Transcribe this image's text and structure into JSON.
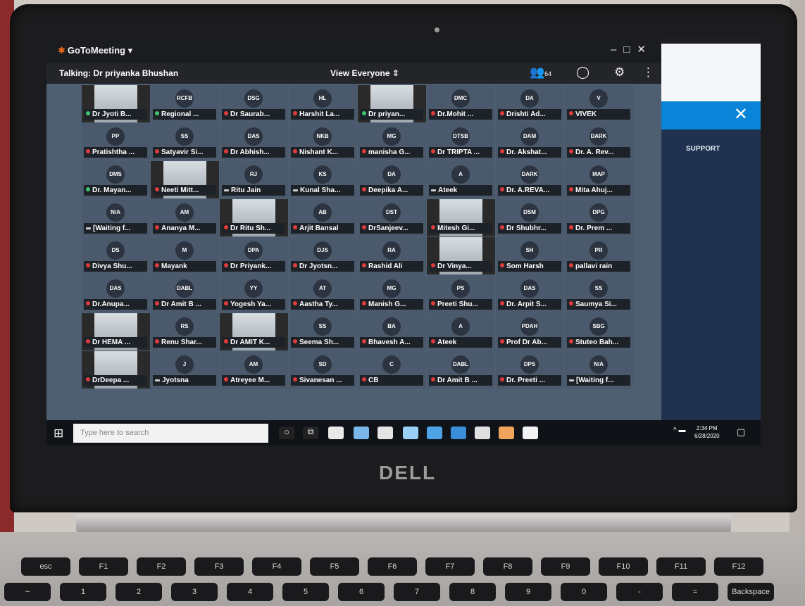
{
  "app": {
    "name": "GoToMeeting",
    "talking": "Talking: Dr priyanka Bhushan",
    "view_mode": "View Everyone",
    "participant_count": "64"
  },
  "side_panel": {
    "close_label": "✕",
    "support_label": "SUPPORT"
  },
  "participants": [
    {
      "initials": "",
      "name": "Dr Jyoti B...",
      "mic": "on",
      "video": true
    },
    {
      "initials": "RCFB",
      "name": "Regional ...",
      "mic": "on",
      "video": false
    },
    {
      "initials": "DSG",
      "name": "Dr Saurab...",
      "mic": "muted",
      "video": false
    },
    {
      "initials": "HL",
      "name": "Harshit La...",
      "mic": "muted",
      "video": false
    },
    {
      "initials": "",
      "name": "Dr priyan...",
      "mic": "on",
      "video": true
    },
    {
      "initials": "DMC",
      "name": "Dr.Mohit ...",
      "mic": "muted",
      "video": false
    },
    {
      "initials": "DA",
      "name": "Drishti Ad...",
      "mic": "muted",
      "video": false
    },
    {
      "initials": "V",
      "name": "VIVEK",
      "mic": "muted",
      "video": false
    },
    {
      "initials": "PP",
      "name": "Pratishtha ...",
      "mic": "muted",
      "video": false
    },
    {
      "initials": "SS",
      "name": "Satyavir Si...",
      "mic": "muted",
      "video": false
    },
    {
      "initials": "DAS",
      "name": "Dr Abhish...",
      "mic": "muted",
      "video": false
    },
    {
      "initials": "NKB",
      "name": "Nishant K...",
      "mic": "muted",
      "video": false
    },
    {
      "initials": "MG",
      "name": "manisha G...",
      "mic": "muted",
      "video": false
    },
    {
      "initials": "DTSB",
      "name": "Dr TRIPTA ...",
      "mic": "muted",
      "video": false
    },
    {
      "initials": "DAM",
      "name": "Dr. Akshat...",
      "mic": "muted",
      "video": false
    },
    {
      "initials": "DARK",
      "name": "Dr. A. Rev...",
      "mic": "muted",
      "video": false
    },
    {
      "initials": "DMS",
      "name": "Dr. Mayan...",
      "mic": "on",
      "video": false
    },
    {
      "initials": "",
      "name": "Neeti Mitt...",
      "mic": "muted",
      "video": true
    },
    {
      "initials": "RJ",
      "name": "Ritu Jain",
      "mic": "none",
      "video": false
    },
    {
      "initials": "KS",
      "name": "Kunal Sha...",
      "mic": "none",
      "video": false
    },
    {
      "initials": "DA",
      "name": "Deepika A...",
      "mic": "muted",
      "video": false
    },
    {
      "initials": "A",
      "name": "Ateek",
      "mic": "none",
      "video": false
    },
    {
      "initials": "DARK",
      "name": "Dr. A.REVA...",
      "mic": "muted",
      "video": false
    },
    {
      "initials": "MAP",
      "name": "Mita Ahuj...",
      "mic": "muted",
      "video": false
    },
    {
      "initials": "N/A",
      "name": "[Waiting f...",
      "mic": "none",
      "video": false
    },
    {
      "initials": "AM",
      "name": "Ananya M...",
      "mic": "muted",
      "video": false
    },
    {
      "initials": "",
      "name": "Dr Ritu Sh...",
      "mic": "muted",
      "video": true
    },
    {
      "initials": "AB",
      "name": "Arjit Bansal",
      "mic": "muted",
      "video": false
    },
    {
      "initials": "DST",
      "name": "DrSanjeev...",
      "mic": "muted",
      "video": false
    },
    {
      "initials": "",
      "name": "Mitesh Gi...",
      "mic": "muted",
      "video": true
    },
    {
      "initials": "DSM",
      "name": "Dr Shubhr...",
      "mic": "muted",
      "video": false
    },
    {
      "initials": "DPG",
      "name": "Dr. Prem ...",
      "mic": "muted",
      "video": false
    },
    {
      "initials": "DS",
      "name": "Divya Shu...",
      "mic": "muted",
      "video": false
    },
    {
      "initials": "M",
      "name": "Mayank",
      "mic": "muted",
      "video": false
    },
    {
      "initials": "DPA",
      "name": "Dr Priyank...",
      "mic": "muted",
      "video": false
    },
    {
      "initials": "DJS",
      "name": "Dr Jyotsn...",
      "mic": "muted",
      "video": false
    },
    {
      "initials": "RA",
      "name": "Rashid Ali",
      "mic": "muted",
      "video": false
    },
    {
      "initials": "",
      "name": "Dr Vinya...",
      "mic": "muted",
      "video": true
    },
    {
      "initials": "SH",
      "name": "Som Harsh",
      "mic": "muted",
      "video": false
    },
    {
      "initials": "PR",
      "name": "pallavi rain",
      "mic": "muted",
      "video": false
    },
    {
      "initials": "DAS",
      "name": "Dr.Anupa...",
      "mic": "muted",
      "video": false
    },
    {
      "initials": "DABL",
      "name": "Dr Amit B ...",
      "mic": "muted",
      "video": false
    },
    {
      "initials": "YY",
      "name": "Yogesh Ya...",
      "mic": "muted",
      "video": false
    },
    {
      "initials": "AT",
      "name": "Aastha Ty...",
      "mic": "muted",
      "video": false
    },
    {
      "initials": "MG",
      "name": "Manish G...",
      "mic": "muted",
      "video": false
    },
    {
      "initials": "PS",
      "name": "Preeti Shu...",
      "mic": "muted",
      "video": false
    },
    {
      "initials": "DAS",
      "name": "Dr. Arpit S...",
      "mic": "muted",
      "video": false
    },
    {
      "initials": "SS",
      "name": "Saumya Si...",
      "mic": "muted",
      "video": false
    },
    {
      "initials": "",
      "name": "Dr HEMA ...",
      "mic": "muted",
      "video": true
    },
    {
      "initials": "RS",
      "name": "Renu Shar...",
      "mic": "muted",
      "video": false
    },
    {
      "initials": "",
      "name": "Dr AMIT K...",
      "mic": "muted",
      "video": true
    },
    {
      "initials": "SS",
      "name": "Seema Sh...",
      "mic": "muted",
      "video": false
    },
    {
      "initials": "BA",
      "name": "Bhavesh A...",
      "mic": "muted",
      "video": false
    },
    {
      "initials": "A",
      "name": "Ateek",
      "mic": "muted",
      "video": false
    },
    {
      "initials": "PDAH",
      "name": "Prof Dr Ab...",
      "mic": "muted",
      "video": false
    },
    {
      "initials": "SBG",
      "name": "Stuteo Bah...",
      "mic": "muted",
      "video": false
    },
    {
      "initials": "",
      "name": "DrDeepa ...",
      "mic": "muted",
      "video": true
    },
    {
      "initials": "J",
      "name": "Jyotsna",
      "mic": "none",
      "video": false
    },
    {
      "initials": "AM",
      "name": "Atreyee M...",
      "mic": "muted",
      "video": false
    },
    {
      "initials": "SD",
      "name": "Sivanesan ...",
      "mic": "muted",
      "video": false
    },
    {
      "initials": "C",
      "name": "CB",
      "mic": "muted",
      "video": false
    },
    {
      "initials": "DABL",
      "name": "Dr Amit B ...",
      "mic": "muted",
      "video": false
    },
    {
      "initials": "DPS",
      "name": "Dr. Preeti ...",
      "mic": "muted",
      "video": false
    },
    {
      "initials": "N/A",
      "name": "[Waiting f...",
      "mic": "none",
      "video": false
    }
  ],
  "taskbar": {
    "search_placeholder": "Type here to search",
    "time": "2:34 PM",
    "date": "6/28/2020"
  },
  "device": {
    "brand": "DELL"
  },
  "keyboard_keys": [
    "esc",
    "F1",
    "F2",
    "F3",
    "F4",
    "F5",
    "F6",
    "F7",
    "F8",
    "F9",
    "F10",
    "F11",
    "F12",
    "~",
    "1",
    "2",
    "3",
    "4",
    "5",
    "6",
    "7",
    "8",
    "9",
    "0",
    "-",
    "=",
    "Backspace"
  ]
}
